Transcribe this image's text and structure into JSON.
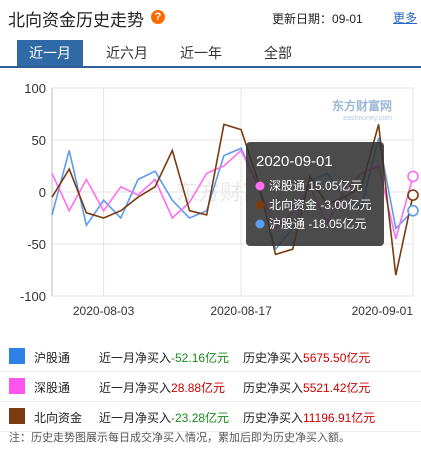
{
  "header": {
    "title": "北向资金历史走势",
    "help_icon": "?",
    "update_label": "更新日期：",
    "update_date": "09-01",
    "more_label": "更多"
  },
  "tabs": [
    {
      "label": "近一月",
      "active": true
    },
    {
      "label": "近六月",
      "active": false
    },
    {
      "label": "近一年",
      "active": false
    },
    {
      "label": "全部",
      "active": false
    }
  ],
  "chart_data": {
    "type": "line",
    "ylim": [
      -100,
      100
    ],
    "yticks": [
      100,
      50,
      0,
      -50,
      -100
    ],
    "x_tick_labels": [
      "2020-08-03",
      "2020-08-17",
      "2020-09-01"
    ],
    "series": [
      {
        "name": "沪股通",
        "color": "#5b9bf2",
        "values": [
          -22,
          40,
          -32,
          -8,
          -25,
          12,
          20,
          -8,
          -25,
          -18,
          35,
          42,
          5,
          -55,
          -35,
          10,
          18,
          -5,
          -15,
          52,
          -35,
          -18
        ]
      },
      {
        "name": "深股通",
        "color": "#ff6ef2",
        "values": [
          18,
          -18,
          12,
          -18,
          5,
          -3,
          12,
          -25,
          -10,
          18,
          25,
          40,
          5,
          -35,
          -20,
          5,
          -30,
          0,
          18,
          25,
          -45,
          15
        ]
      },
      {
        "name": "北向资金",
        "color": "#7a3b10",
        "values": [
          -5,
          22,
          -20,
          -25,
          -18,
          -5,
          5,
          40,
          -18,
          -22,
          65,
          60,
          10,
          -60,
          -55,
          15,
          -12,
          -5,
          5,
          65,
          -80,
          -3
        ]
      }
    ],
    "tooltip": {
      "date": "2020-09-01",
      "items": [
        {
          "label": "深股通 15.05亿元",
          "color": "#ff6ef2"
        },
        {
          "label": "北向资金 -3.00亿元",
          "color": "#7a3b10"
        },
        {
          "label": "沪股通 -18.05亿元",
          "color": "#5b9bf2"
        }
      ]
    },
    "watermark": "东方财富网",
    "watermark_sub": "eastmoney.com",
    "center_watermark": "东方财富"
  },
  "legend": [
    {
      "name": "沪股通",
      "color": "#2e82e6",
      "month_label": "近一月净买入",
      "month_value": "-52.16亿元",
      "hist_label": "历史净买入",
      "hist_value": "5675.50亿元"
    },
    {
      "name": "深股通",
      "color": "#ff55ee",
      "month_label": "近一月净买入",
      "month_value": "28.88亿元",
      "hist_label": "历史净买入",
      "hist_value": "5521.42亿元"
    },
    {
      "name": "北向资金",
      "color": "#7a3b10",
      "month_label": "近一月净买入",
      "month_value": "-23.28亿元",
      "hist_label": "历史净买入",
      "hist_value": "11196.91亿元"
    }
  ],
  "note": "注：历史走势图展示每日成交净买入情况，累加后即为历史净买入额。"
}
